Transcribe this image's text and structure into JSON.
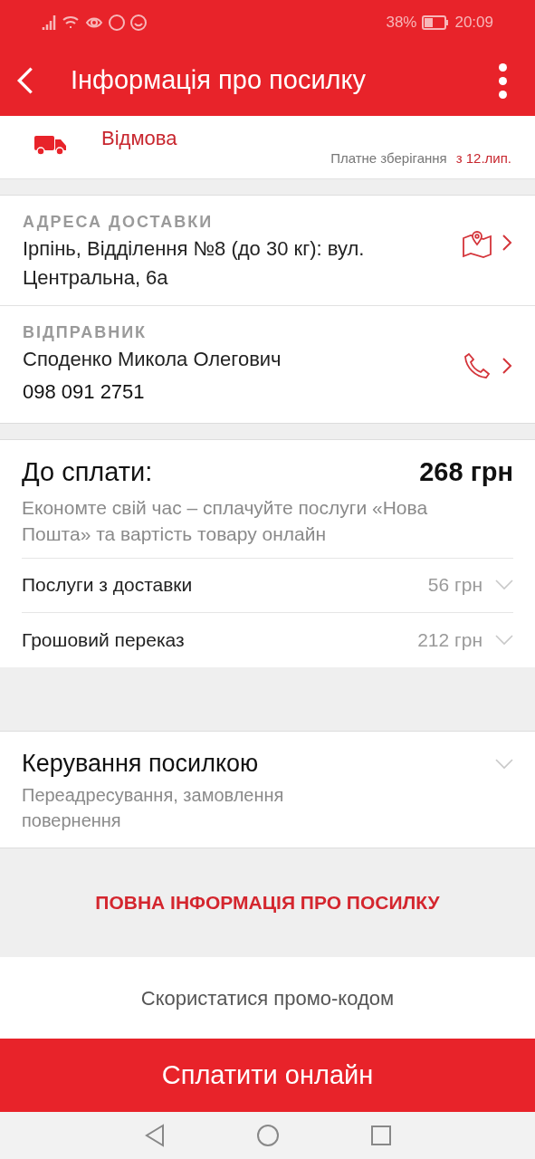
{
  "status_bar": {
    "battery": "38%",
    "time": "20:09"
  },
  "app_bar": {
    "title": "Інформація про посилку"
  },
  "parcel_status": {
    "status": "Відмова",
    "storage_label": "Платне зберігання",
    "storage_date": "з 12.лип."
  },
  "delivery_address": {
    "label": "АДРЕСА ДОСТАВКИ",
    "value": "Ірпінь, Відділення №8 (до 30 кг): вул. Центральна, 6а"
  },
  "sender": {
    "label": "ВІДПРАВНИК",
    "name": "Споденко Микола Олегович",
    "phone": "098 091 2751"
  },
  "payment": {
    "label": "До сплати:",
    "total": "268 грн",
    "hint": "Економте свій час – сплачуйте послуги «Нова Пошта» та вартість товару онлайн",
    "items": [
      {
        "label": "Послуги з доставки",
        "amount": "56 грн"
      },
      {
        "label": "Грошовий переказ",
        "amount": "212 грн"
      }
    ]
  },
  "management": {
    "title": "Керування посилкою",
    "subtitle": "Переадресування, замовлення повернення"
  },
  "full_info_link": "ПОВНА ІНФОРМАЦІЯ ПРО ПОСИЛКУ",
  "promo_link": "Скористатися промо-кодом",
  "pay_button": "Сплатити онлайн"
}
